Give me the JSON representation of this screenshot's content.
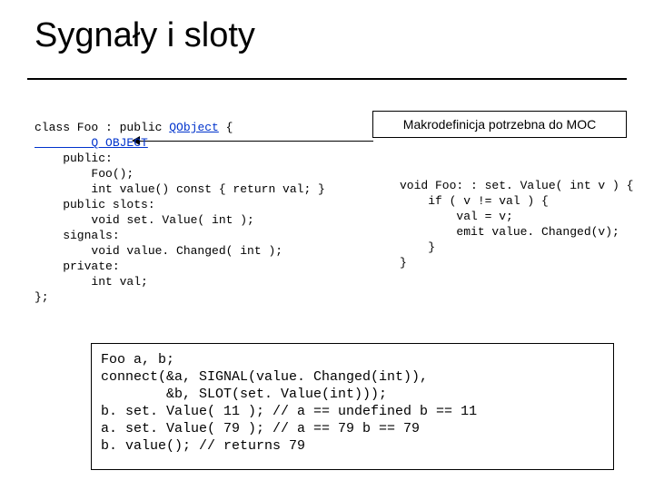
{
  "title": "Sygnały i sloty",
  "callout": "Makrodefinicja potrzebna do MOC",
  "code_left": {
    "l01a": "class Foo : public ",
    "l01b": "QObject",
    "l01c": " {",
    "l02": "        Q_OBJECT",
    "l03": "    public:",
    "l04": "        Foo();",
    "l05": "        int value() const { return val; }",
    "l06": "    public slots:",
    "l07": "        void set. Value( int );",
    "l08": "    signals:",
    "l09": "        void value. Changed( int );",
    "l10": "    private:",
    "l11": "        int val;",
    "l12": "};"
  },
  "code_right": {
    "l1": "void Foo: : set. Value( int v ) {",
    "l2": "    if ( v != val ) {",
    "l3": "        val = v;",
    "l4": "        emit value. Changed(v);",
    "l5": "    }",
    "l6": "}"
  },
  "code_bottom": {
    "l1": "Foo a, b;",
    "l2": "connect(&a, SIGNAL(value. Changed(int)),",
    "l3": "        &b, SLOT(set. Value(int)));",
    "l4": "b. set. Value( 11 ); // a == undefined b == 11",
    "l5": "a. set. Value( 79 ); // a == 79 b == 79",
    "l6": "b. value(); // returns 79"
  }
}
